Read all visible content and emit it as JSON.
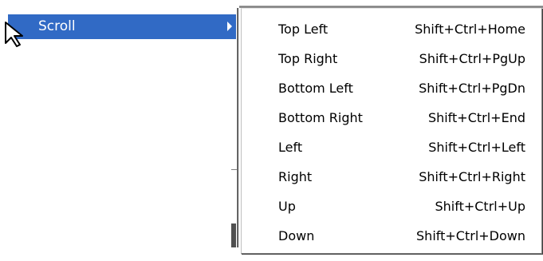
{
  "parent_menu": {
    "label": "Scroll",
    "arrow_icon": "chevron-right-icon",
    "highlight_color": "#316ac5"
  },
  "submenu": {
    "items": [
      {
        "label": "Top Left",
        "shortcut": "Shift+Ctrl+Home"
      },
      {
        "label": "Top Right",
        "shortcut": "Shift+Ctrl+PgUp"
      },
      {
        "label": "Bottom Left",
        "shortcut": "Shift+Ctrl+PgDn"
      },
      {
        "label": "Bottom Right",
        "shortcut": "Shift+Ctrl+End"
      },
      {
        "label": "Left",
        "shortcut": "Shift+Ctrl+Left"
      },
      {
        "label": "Right",
        "shortcut": "Shift+Ctrl+Right"
      },
      {
        "label": "Up",
        "shortcut": "Shift+Ctrl+Up"
      },
      {
        "label": "Down",
        "shortcut": "Shift+Ctrl+Down"
      }
    ]
  },
  "pointer_icon": "mouse-pointer-icon"
}
